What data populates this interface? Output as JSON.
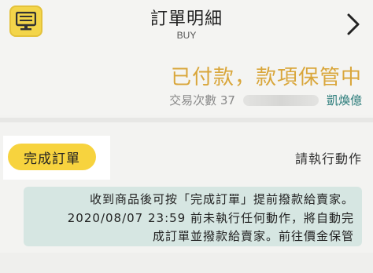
{
  "header": {
    "title": "訂單明細",
    "subtitle": "BUY",
    "left_icon": "monitor-icon",
    "right_icon": "chevron-right-icon"
  },
  "status": {
    "title": "已付款，款項保管中",
    "meta_count": "交易次數 37",
    "meta_seller": "凱煥億"
  },
  "action": {
    "prompt": "請執行動作",
    "button_label": "完成訂單"
  },
  "notice": {
    "line1": "收到商品後可按「完成訂單」提前撥款給賣家。",
    "line2": "2020/08/07 23:59 前未執行任何動作，將自動完",
    "line3": "成訂單並撥款給賣家。前往價金保管"
  },
  "colors": {
    "accent_yellow": "#f7d33e",
    "status_orange": "#d9a63a",
    "notice_bg": "#d6e6e2",
    "seller_teal": "#2b7c7a"
  }
}
